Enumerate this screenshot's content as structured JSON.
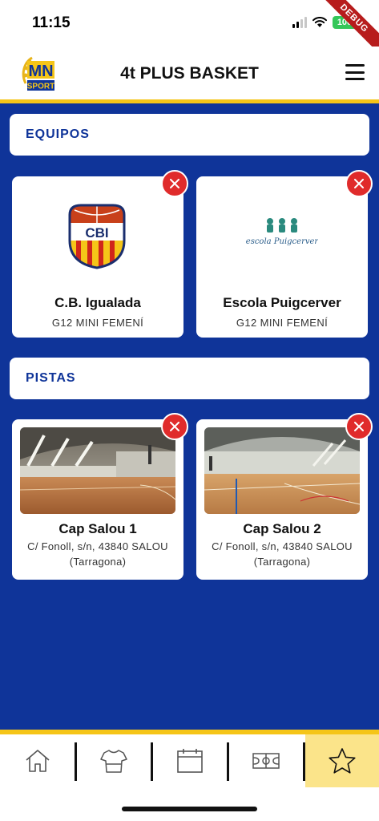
{
  "status": {
    "time": "11:15",
    "battery": "100",
    "debug": "DEBUG"
  },
  "header": {
    "title": "4t PLUS BASKET",
    "logo_top": "MN",
    "logo_bottom": "SPORT"
  },
  "sections": {
    "teams": "EQUIPOS",
    "courts": "PISTAS"
  },
  "teams": [
    {
      "name": "C.B. Igualada",
      "category": "G12  MINI FEMENÍ",
      "logo_text": "CBI"
    },
    {
      "name": "Escola Puigcerver",
      "category": "G12  MINI FEMENÍ",
      "logo_text": "escola Puigcerver"
    }
  ],
  "courts": [
    {
      "name": "Cap Salou 1",
      "address_line1": "C/ Fonoll, s/n, 43840 SALOU",
      "address_line2": "(Tarragona)"
    },
    {
      "name": "Cap Salou 2",
      "address_line1": "C/ Fonoll, s/n, 43840 SALOU",
      "address_line2": "(Tarragona)"
    }
  ],
  "nav": {
    "items": [
      "home-icon",
      "jersey-icon",
      "calendar-icon",
      "court-icon",
      "star-icon"
    ],
    "active": "star-icon"
  },
  "colors": {
    "primary": "#0f3499",
    "accent": "#f5c518",
    "close": "#e02b2b"
  }
}
